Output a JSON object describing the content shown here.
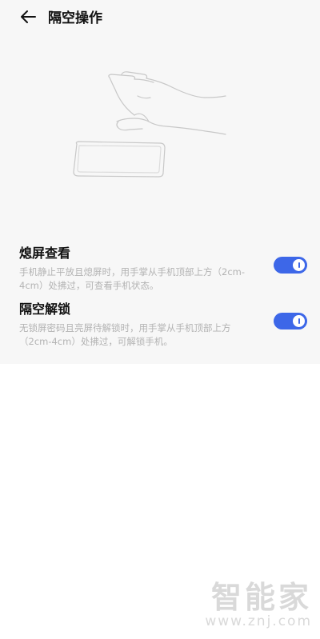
{
  "header": {
    "title": "隔空操作"
  },
  "settings": [
    {
      "label": "熄屏查看",
      "description": "手机静止平放且熄屏时，用手掌从手机顶部上方（2cm-4cm）处拂过，可查看手机状态。",
      "enabled": true
    },
    {
      "label": "隔空解锁",
      "description": "无锁屏密码且亮屏待解锁时，用手掌从手机顶部上方（2cm-4cm）处拂过，可解锁手机。",
      "enabled": true
    }
  ],
  "watermark": {
    "logo": "智能家",
    "url": "www.znj.com"
  },
  "colors": {
    "accent": "#3d67e8",
    "background": "#f7f7f7",
    "secondary_text": "#b3b3b3"
  },
  "icons": {
    "back": "arrow-left-icon",
    "illustration": "hand-over-phone-illustration"
  }
}
